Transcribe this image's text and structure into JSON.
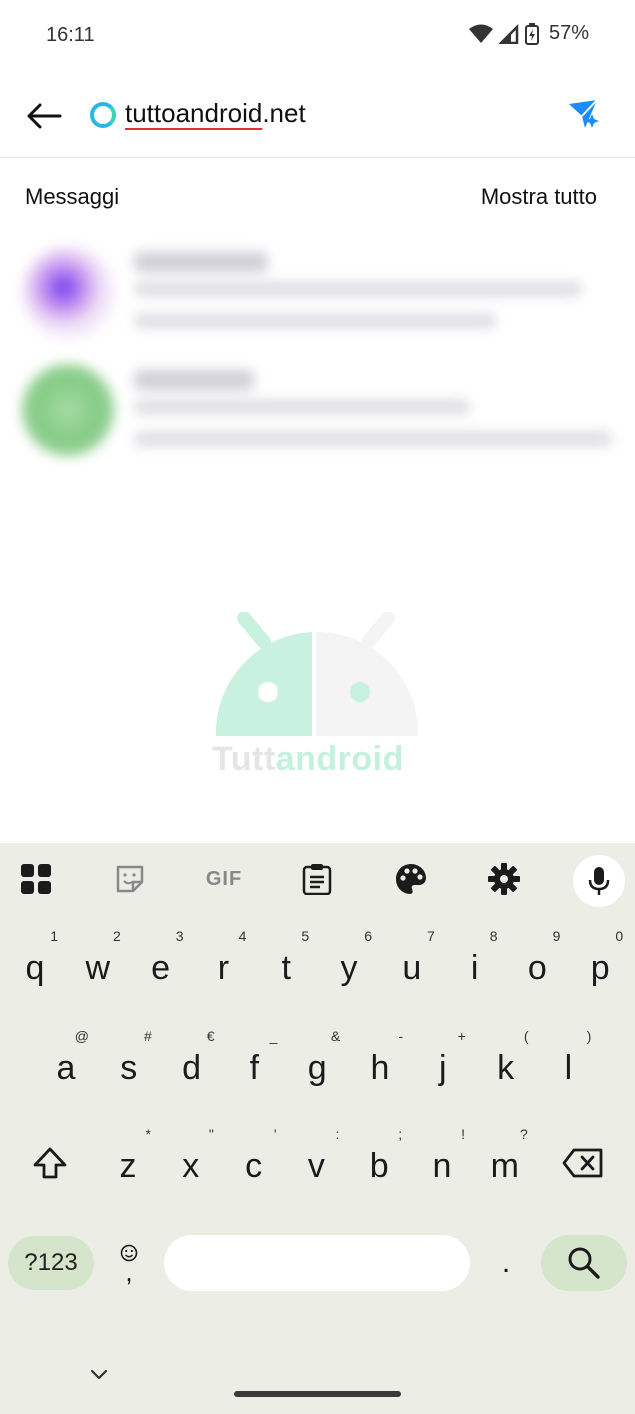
{
  "status_bar": {
    "time": "16:11",
    "battery": "57%"
  },
  "search": {
    "query_underlined": "tuttoandroid",
    "query_rest": ".net"
  },
  "messages_section": {
    "title": "Messaggi",
    "show_all": "Mostra tutto"
  },
  "watermark": {
    "part1": "Tutt",
    "part2": "android"
  },
  "keyboard": {
    "toolbar": [
      "apps-grid-icon",
      "sticker-icon",
      "gif-icon",
      "clipboard-icon",
      "palette-icon",
      "gear-icon",
      "mic-icon"
    ],
    "gif_label": "GIF",
    "row1": [
      {
        "k": "q",
        "h": "1"
      },
      {
        "k": "w",
        "h": "2"
      },
      {
        "k": "e",
        "h": "3"
      },
      {
        "k": "r",
        "h": "4"
      },
      {
        "k": "t",
        "h": "5"
      },
      {
        "k": "y",
        "h": "6"
      },
      {
        "k": "u",
        "h": "7"
      },
      {
        "k": "i",
        "h": "8"
      },
      {
        "k": "o",
        "h": "9"
      },
      {
        "k": "p",
        "h": "0"
      }
    ],
    "row2": [
      {
        "k": "a",
        "h": "@"
      },
      {
        "k": "s",
        "h": "#"
      },
      {
        "k": "d",
        "h": "€"
      },
      {
        "k": "f",
        "h": "_"
      },
      {
        "k": "g",
        "h": "&"
      },
      {
        "k": "h",
        "h": "-"
      },
      {
        "k": "j",
        "h": "+"
      },
      {
        "k": "k",
        "h": "("
      },
      {
        "k": "l",
        "h": ")"
      }
    ],
    "row3": [
      {
        "k": "z",
        "h": "*"
      },
      {
        "k": "x",
        "h": "\""
      },
      {
        "k": "c",
        "h": "'"
      },
      {
        "k": "v",
        "h": ":"
      },
      {
        "k": "b",
        "h": ";"
      },
      {
        "k": "n",
        "h": "!"
      },
      {
        "k": "m",
        "h": "?"
      }
    ],
    "symbols_label": "?123",
    "comma": ",",
    "period": "."
  },
  "colors": {
    "accent": "#1a8cff",
    "keyboard_bg": "#eceee6",
    "key_action_bg": "#d5e5cc"
  }
}
